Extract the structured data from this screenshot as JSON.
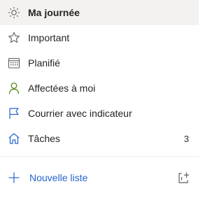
{
  "colors": {
    "accent": "#2564cf",
    "assigned_icon": "#498205",
    "home_icon": "#2564cf",
    "selected_bg": "#f3f2f1"
  },
  "nav": {
    "items": [
      {
        "label": "Ma journée",
        "icon": "sun-icon",
        "selected": true
      },
      {
        "label": "Important",
        "icon": "star-icon"
      },
      {
        "label": "Planifié",
        "icon": "calendar-icon"
      },
      {
        "label": "Affectées à moi",
        "icon": "person-icon"
      },
      {
        "label": "Courrier avec indicateur",
        "icon": "flag-icon"
      },
      {
        "label": "Tâches",
        "icon": "home-icon",
        "count": "3"
      }
    ]
  },
  "footer": {
    "new_list_label": "Nouvelle liste",
    "new_list_icon": "plus-icon",
    "new_group_icon": "new-group-icon"
  }
}
